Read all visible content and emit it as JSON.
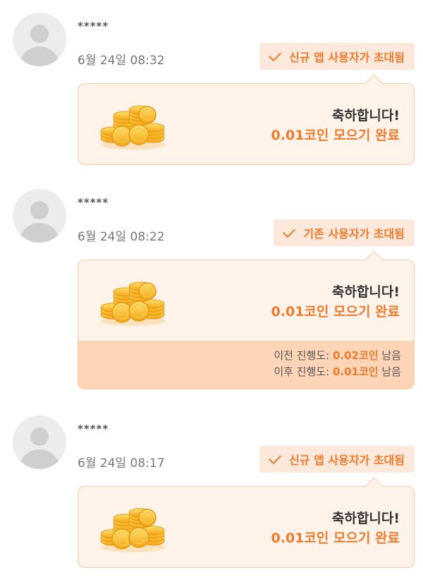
{
  "colors": {
    "accent": "#f07a2c",
    "card_bg": "#fff3ea",
    "tag_bg": "#fde9dc",
    "progress_bg": "#fed5b6"
  },
  "entries": [
    {
      "username": "*****",
      "time": "6월 24일 08:32",
      "tag": "신규 앱 사용자가 초대됨",
      "tag_icon": "check-icon",
      "congrats": "축하합니다!",
      "reward": "0.01코인 모으기 완료",
      "image": "gold-coins-icon"
    },
    {
      "username": "*****",
      "time": "6월 24일 08:22",
      "tag": "기존 사용자가 초대됨",
      "tag_icon": "check-icon",
      "congrats": "축하합니다!",
      "reward": "0.01코인 모으기 완료",
      "image": "gold-coins-icon",
      "progress": {
        "before_label": "이전 진행도:",
        "before_value": "0.02코인",
        "before_suffix": "남음",
        "after_label": "이후 진행도:",
        "after_value": "0.01코인",
        "after_suffix": "남음"
      }
    },
    {
      "username": "*****",
      "time": "6월 24일 08:17",
      "tag": "신규 앱 사용자가 초대됨",
      "tag_icon": "check-icon",
      "congrats": "축하합니다!",
      "reward": "0.01코인 모으기 완료",
      "image": "gold-coins-icon"
    }
  ]
}
